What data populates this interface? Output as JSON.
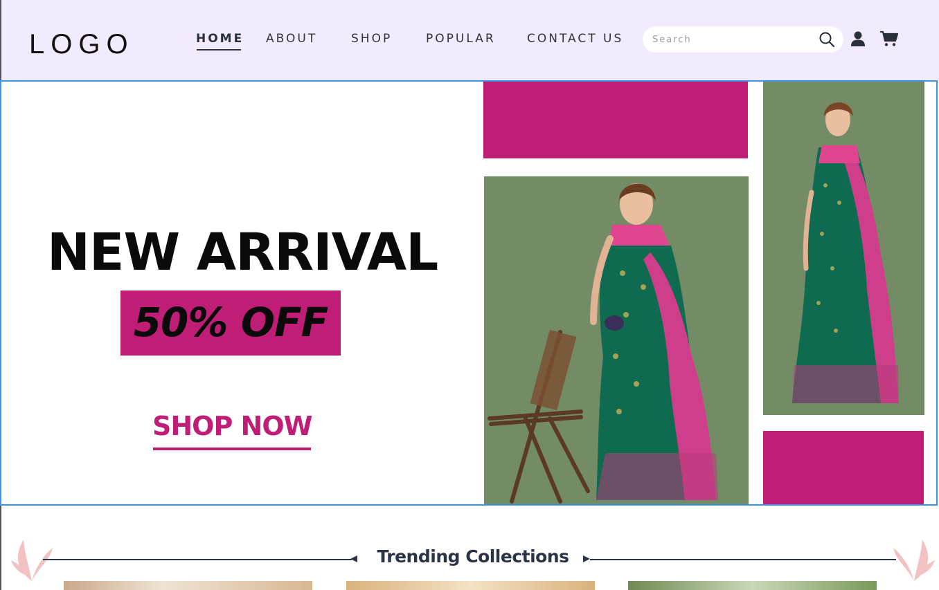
{
  "header": {
    "logo": "LOGO",
    "nav": [
      {
        "label": "HOME",
        "active": true
      },
      {
        "label": "ABOUT",
        "active": false
      },
      {
        "label": "SHOP",
        "active": false
      },
      {
        "label": "POPULAR",
        "active": false
      },
      {
        "label": "CONTACT US",
        "active": false
      }
    ],
    "search": {
      "placeholder": "Search",
      "value": ""
    },
    "icons": [
      "search-icon",
      "user-icon",
      "cart-icon"
    ]
  },
  "hero": {
    "headline": "NEW ARRIVAL",
    "offer": "50% OFF",
    "cta": "SHOP NOW"
  },
  "trending": {
    "title": "Trending Collections"
  },
  "colors": {
    "accent": "#c01e76",
    "header_bg": "#f1ebfd",
    "photo_bg": "#738c65",
    "text_dark": "#2b3447",
    "hero_border": "#3b94e6"
  }
}
